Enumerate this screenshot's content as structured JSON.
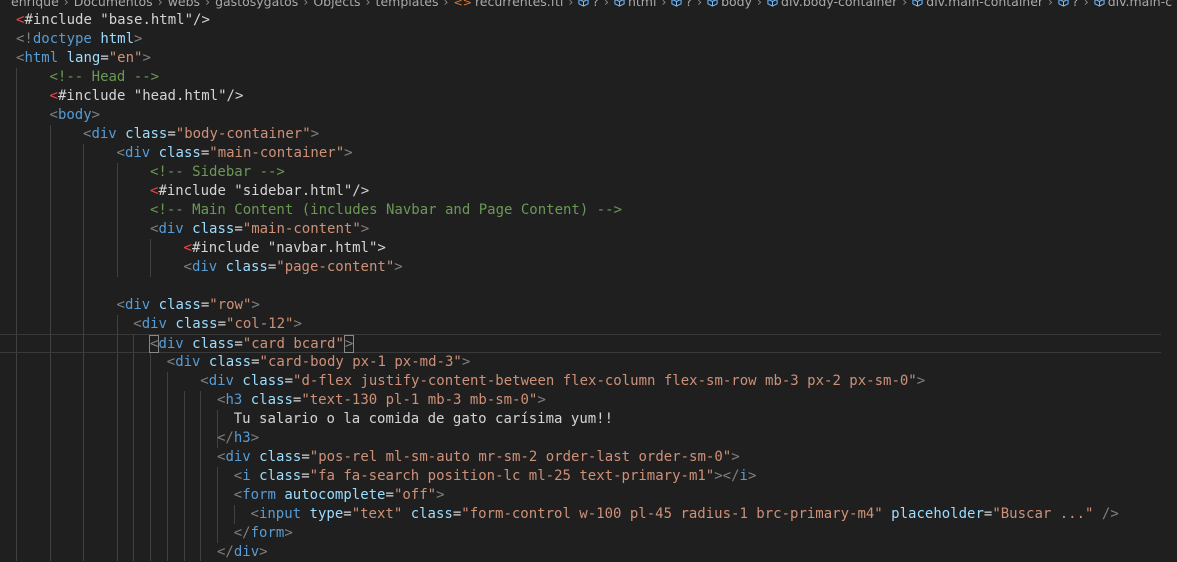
{
  "breadcrumb": [
    {
      "label": "enrique",
      "icon": ""
    },
    {
      "label": "Documentos",
      "icon": ""
    },
    {
      "label": "webs",
      "icon": ""
    },
    {
      "label": "gastosygatos",
      "icon": ""
    },
    {
      "label": "Objects",
      "icon": ""
    },
    {
      "label": "templates",
      "icon": ""
    },
    {
      "label": "recurrentes.ftl",
      "icon": "file-code-icon"
    },
    {
      "label": "?",
      "icon": "cube-icon"
    },
    {
      "label": "html",
      "icon": "cube-icon"
    },
    {
      "label": "?",
      "icon": "cube-icon"
    },
    {
      "label": "body",
      "icon": "cube-icon"
    },
    {
      "label": "div.body-container",
      "icon": "cube-icon"
    },
    {
      "label": "div.main-container",
      "icon": "cube-icon"
    },
    {
      "label": "?",
      "icon": "cube-icon"
    },
    {
      "label": "div.main-c",
      "icon": "cube-icon"
    }
  ],
  "colors": {
    "background": "#1f1f1f",
    "tag": "#569cd6",
    "attribute": "#9cdcfe",
    "string": "#ce9178",
    "comment": "#6a9955",
    "punctuation": "#808080",
    "text": "#d4d4d4",
    "error_marker": "#f44747"
  },
  "code_lines": [
    {
      "indent": 0,
      "tokens": [
        [
          "red",
          "<"
        ],
        [
          "text",
          "#include \"base.html\"/>"
        ]
      ]
    },
    {
      "indent": 0,
      "tokens": [
        [
          "punc",
          "<!"
        ],
        [
          "tag",
          "doctype"
        ],
        [
          "text",
          " "
        ],
        [
          "attr",
          "html"
        ],
        [
          "punc",
          ">"
        ]
      ]
    },
    {
      "indent": 0,
      "tokens": [
        [
          "punc",
          "<"
        ],
        [
          "tag",
          "html"
        ],
        [
          "text",
          " "
        ],
        [
          "attr",
          "lang"
        ],
        [
          "text",
          "="
        ],
        [
          "str",
          "\"en\""
        ],
        [
          "punc",
          ">"
        ]
      ]
    },
    {
      "indent": 1,
      "tokens": [
        [
          "com",
          "<!-- Head -->"
        ]
      ]
    },
    {
      "indent": 1,
      "tokens": [
        [
          "red",
          "<"
        ],
        [
          "text",
          "#include \"head.html\"/>"
        ]
      ]
    },
    {
      "indent": 1,
      "tokens": [
        [
          "punc",
          "<"
        ],
        [
          "tag",
          "body"
        ],
        [
          "punc",
          ">"
        ]
      ]
    },
    {
      "indent": 2,
      "tokens": [
        [
          "punc",
          "<"
        ],
        [
          "tag",
          "div"
        ],
        [
          "text",
          " "
        ],
        [
          "attr",
          "class"
        ],
        [
          "text",
          "="
        ],
        [
          "str",
          "\"body-container\""
        ],
        [
          "punc",
          ">"
        ]
      ]
    },
    {
      "indent": 3,
      "tokens": [
        [
          "punc",
          "<"
        ],
        [
          "tag",
          "div"
        ],
        [
          "text",
          " "
        ],
        [
          "attr",
          "class"
        ],
        [
          "text",
          "="
        ],
        [
          "str",
          "\"main-container\""
        ],
        [
          "punc",
          ">"
        ]
      ]
    },
    {
      "indent": 4,
      "tokens": [
        [
          "com",
          "<!-- Sidebar -->"
        ]
      ]
    },
    {
      "indent": 4,
      "tokens": [
        [
          "red",
          "<"
        ],
        [
          "text",
          "#include \"sidebar.html\"/>"
        ]
      ]
    },
    {
      "indent": 4,
      "tokens": [
        [
          "com",
          "<!-- Main Content (includes Navbar and Page Content) -->"
        ]
      ]
    },
    {
      "indent": 4,
      "tokens": [
        [
          "punc",
          "<"
        ],
        [
          "tag",
          "div"
        ],
        [
          "text",
          " "
        ],
        [
          "attr",
          "class"
        ],
        [
          "text",
          "="
        ],
        [
          "str",
          "\"main-content\""
        ],
        [
          "punc",
          ">"
        ]
      ]
    },
    {
      "indent": 5,
      "tokens": [
        [
          "red",
          "<"
        ],
        [
          "text",
          "#include \"navbar.html\">"
        ]
      ]
    },
    {
      "indent": 5,
      "tokens": [
        [
          "punc",
          "<"
        ],
        [
          "tag",
          "div"
        ],
        [
          "text",
          " "
        ],
        [
          "attr",
          "class"
        ],
        [
          "text",
          "="
        ],
        [
          "str",
          "\"page-content\""
        ],
        [
          "punc",
          ">"
        ]
      ]
    },
    {
      "indent": 0,
      "tokens": []
    },
    {
      "indent": 3,
      "tokens": [
        [
          "punc",
          "<"
        ],
        [
          "tag",
          "div"
        ],
        [
          "text",
          " "
        ],
        [
          "attr",
          "class"
        ],
        [
          "text",
          "="
        ],
        [
          "str",
          "\"row\""
        ],
        [
          "punc",
          ">"
        ]
      ]
    },
    {
      "indent": 3.5,
      "tokens": [
        [
          "punc",
          "<"
        ],
        [
          "tag",
          "div"
        ],
        [
          "text",
          " "
        ],
        [
          "attr",
          "class"
        ],
        [
          "text",
          "="
        ],
        [
          "str",
          "\"col-12\""
        ],
        [
          "punc",
          ">"
        ]
      ]
    },
    {
      "indent": 4,
      "current": true,
      "tokens": [
        [
          "punc",
          "<"
        ],
        [
          "tag",
          "div"
        ],
        [
          "text",
          " "
        ],
        [
          "attr",
          "class"
        ],
        [
          "text",
          "="
        ],
        [
          "str",
          "\"card bcard\""
        ],
        [
          "punc",
          ">"
        ]
      ]
    },
    {
      "indent": 4.5,
      "tokens": [
        [
          "punc",
          "<"
        ],
        [
          "tag",
          "div"
        ],
        [
          "text",
          " "
        ],
        [
          "attr",
          "class"
        ],
        [
          "text",
          "="
        ],
        [
          "str",
          "\"card-body px-1 px-md-3\""
        ],
        [
          "punc",
          ">"
        ]
      ]
    },
    {
      "indent": 5.5,
      "tokens": [
        [
          "punc",
          "<"
        ],
        [
          "tag",
          "div"
        ],
        [
          "text",
          " "
        ],
        [
          "attr",
          "class"
        ],
        [
          "text",
          "="
        ],
        [
          "str",
          "\"d-flex justify-content-between flex-column flex-sm-row mb-3 px-2 px-sm-0\""
        ],
        [
          "punc",
          ">"
        ]
      ]
    },
    {
      "indent": 6,
      "tokens": [
        [
          "punc",
          "<"
        ],
        [
          "tag",
          "h3"
        ],
        [
          "text",
          " "
        ],
        [
          "attr",
          "class"
        ],
        [
          "text",
          "="
        ],
        [
          "str",
          "\"text-130 pl-1 mb-3 mb-sm-0\""
        ],
        [
          "punc",
          ">"
        ]
      ]
    },
    {
      "indent": 6.5,
      "tokens": [
        [
          "text",
          "Tu salario o la comida de gato carísima yum!!"
        ]
      ]
    },
    {
      "indent": 6,
      "tokens": [
        [
          "punc",
          "</"
        ],
        [
          "tag",
          "h3"
        ],
        [
          "punc",
          ">"
        ]
      ]
    },
    {
      "indent": 6,
      "tokens": [
        [
          "punc",
          "<"
        ],
        [
          "tag",
          "div"
        ],
        [
          "text",
          " "
        ],
        [
          "attr",
          "class"
        ],
        [
          "text",
          "="
        ],
        [
          "str",
          "\"pos-rel ml-sm-auto mr-sm-2 order-last order-sm-0\""
        ],
        [
          "punc",
          ">"
        ]
      ]
    },
    {
      "indent": 6.5,
      "tokens": [
        [
          "punc",
          "<"
        ],
        [
          "tag",
          "i"
        ],
        [
          "text",
          " "
        ],
        [
          "attr",
          "class"
        ],
        [
          "text",
          "="
        ],
        [
          "str",
          "\"fa fa-search position-lc ml-25 text-primary-m1\""
        ],
        [
          "punc",
          "></"
        ],
        [
          "tag",
          "i"
        ],
        [
          "punc",
          ">"
        ]
      ]
    },
    {
      "indent": 6.5,
      "tokens": [
        [
          "punc",
          "<"
        ],
        [
          "tag",
          "form"
        ],
        [
          "text",
          " "
        ],
        [
          "attr",
          "autocomplete"
        ],
        [
          "text",
          "="
        ],
        [
          "str",
          "\"off\""
        ],
        [
          "punc",
          ">"
        ]
      ]
    },
    {
      "indent": 7,
      "tokens": [
        [
          "punc",
          "<"
        ],
        [
          "tag",
          "input"
        ],
        [
          "text",
          " "
        ],
        [
          "attr",
          "type"
        ],
        [
          "text",
          "="
        ],
        [
          "str",
          "\"text\""
        ],
        [
          "text",
          " "
        ],
        [
          "attr",
          "class"
        ],
        [
          "text",
          "="
        ],
        [
          "str",
          "\"form-control w-100 pl-45 radius-1 brc-primary-m4\""
        ],
        [
          "text",
          " "
        ],
        [
          "attr",
          "placeholder"
        ],
        [
          "text",
          "="
        ],
        [
          "str",
          "\"Buscar ...\""
        ],
        [
          "text",
          " "
        ],
        [
          "punc",
          "/>"
        ]
      ]
    },
    {
      "indent": 6.5,
      "tokens": [
        [
          "punc",
          "</"
        ],
        [
          "tag",
          "form"
        ],
        [
          "punc",
          ">"
        ]
      ]
    },
    {
      "indent": 6,
      "tokens": [
        [
          "punc",
          "</"
        ],
        [
          "tag",
          "div"
        ],
        [
          "punc",
          ">"
        ]
      ]
    }
  ]
}
